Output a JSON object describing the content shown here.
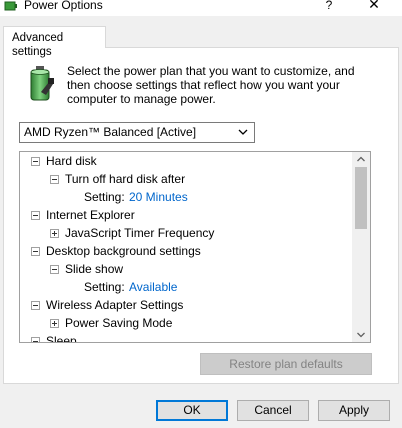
{
  "window": {
    "title": "Power Options",
    "help_label": "?",
    "close_label": "✕"
  },
  "tabs": [
    {
      "label": "Advanced settings",
      "selected": true
    }
  ],
  "description": "Select the power plan that you want to customize, and then choose settings that reflect how you want your computer to manage power.",
  "plan_select": {
    "value": "AMD Ryzen™ Balanced [Active]"
  },
  "tree": {
    "hard_disk": {
      "label": "Hard disk",
      "expander": "minus"
    },
    "turn_off_hard_disk": {
      "label": "Turn off hard disk after",
      "expander": "minus"
    },
    "hard_disk_setting": {
      "label": "Setting:",
      "value": "20 Minutes"
    },
    "internet_explorer": {
      "label": "Internet Explorer",
      "expander": "minus"
    },
    "js_timer": {
      "label": "JavaScript Timer Frequency",
      "expander": "plus"
    },
    "desktop_bg": {
      "label": "Desktop background settings",
      "expander": "minus"
    },
    "slide_show": {
      "label": "Slide show",
      "expander": "minus"
    },
    "slide_show_setting": {
      "label": "Setting:",
      "value": "Available"
    },
    "wireless": {
      "label": "Wireless Adapter Settings",
      "expander": "minus"
    },
    "power_saving": {
      "label": "Power Saving Mode",
      "expander": "plus"
    },
    "sleep": {
      "label": "Sleep",
      "expander": "minus"
    }
  },
  "buttons": {
    "restore": "Restore plan defaults",
    "ok": "OK",
    "cancel": "Cancel",
    "apply": "Apply"
  },
  "colors": {
    "link_value": "#0066cc",
    "ok_border": "#0078d7",
    "disabled_text": "#838383"
  }
}
